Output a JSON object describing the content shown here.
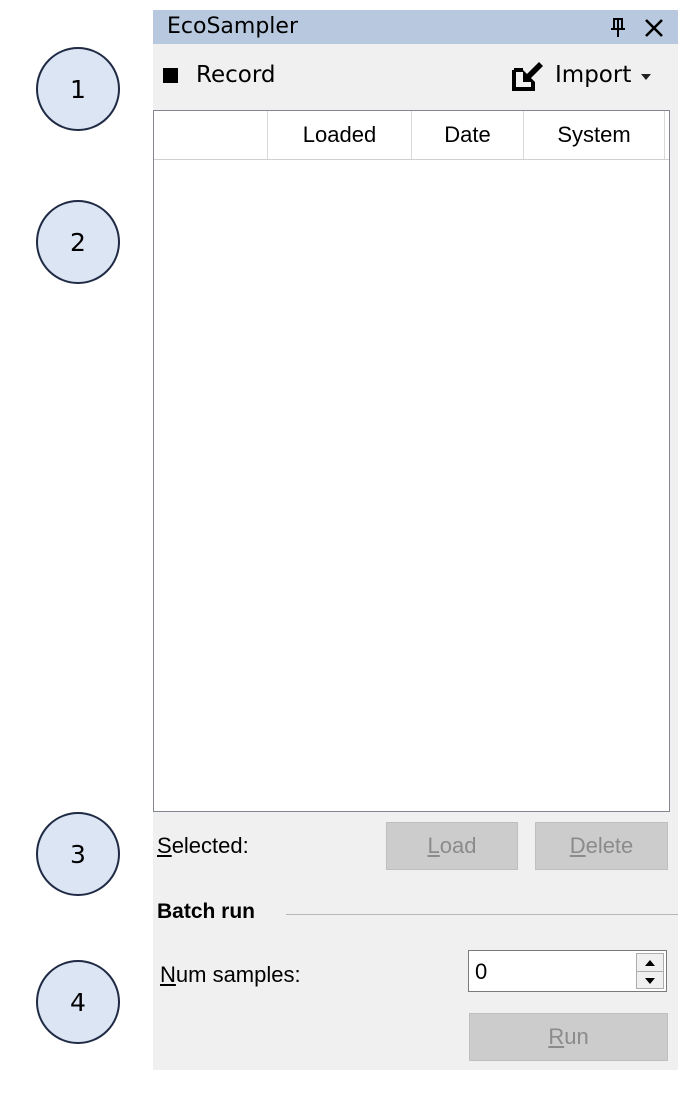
{
  "callouts": [
    "1",
    "2",
    "3",
    "4"
  ],
  "window": {
    "title": "EcoSampler",
    "pin_icon": "pin-icon",
    "close_icon": "close-icon"
  },
  "toolbar": {
    "record_label": "Record",
    "record_icon": "stop-square-icon",
    "import_label": "Import",
    "import_icon": "import-icon",
    "import_dropdown_icon": "chevron-down-icon"
  },
  "list": {
    "columns": [
      "",
      "Loaded",
      "Date",
      "System"
    ],
    "rows": []
  },
  "selected": {
    "label_first": "S",
    "label_rest": "elected:",
    "load_first": "L",
    "load_rest": "oad",
    "delete_first": "D",
    "delete_rest": "elete"
  },
  "batch": {
    "title": "Batch run",
    "num_first": "N",
    "num_rest": "um samples:",
    "num_value": "0",
    "run_first": "R",
    "run_rest": "un"
  },
  "colors": {
    "titlebar": "#b7c8df",
    "panel": "#f0f0f0",
    "callout_fill": "#dbe5f3",
    "disabled_button": "#cccccc",
    "disabled_text": "#8b8b8b"
  }
}
